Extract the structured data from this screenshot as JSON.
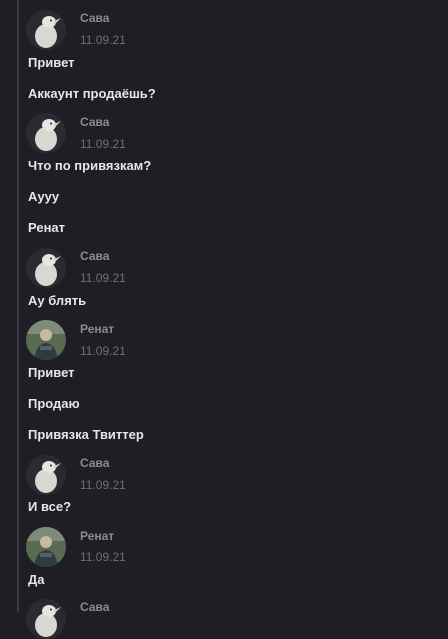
{
  "messages": [
    {
      "author": "Сава",
      "date": "11.09.21",
      "lines": [
        "Привет",
        "Аккаунт продаёшь?"
      ]
    },
    {
      "author": "Сава",
      "date": "11.09.21",
      "lines": [
        "Что по привязкам?",
        "Аууу",
        "Ренат"
      ]
    },
    {
      "author": "Сава",
      "date": "11.09.21",
      "lines": [
        "Ау блять"
      ]
    },
    {
      "author": "Ренат",
      "date": "11.09.21",
      "lines": [
        "Привет",
        "Продаю",
        "Привязка Твиттер"
      ]
    },
    {
      "author": "Сава",
      "date": "11.09.21",
      "lines": [
        "И все?"
      ]
    },
    {
      "author": "Ренат",
      "date": "11.09.21",
      "lines": [
        "Да"
      ]
    },
    {
      "author": "Сава",
      "date": "",
      "lines": []
    }
  ],
  "avatars": {
    "Сава": {
      "icon": "bird-avatar-icon",
      "bg": "#2b2a30"
    },
    "Ренат": {
      "icon": "person-avatar-icon",
      "bg": "#4a5a46"
    }
  }
}
